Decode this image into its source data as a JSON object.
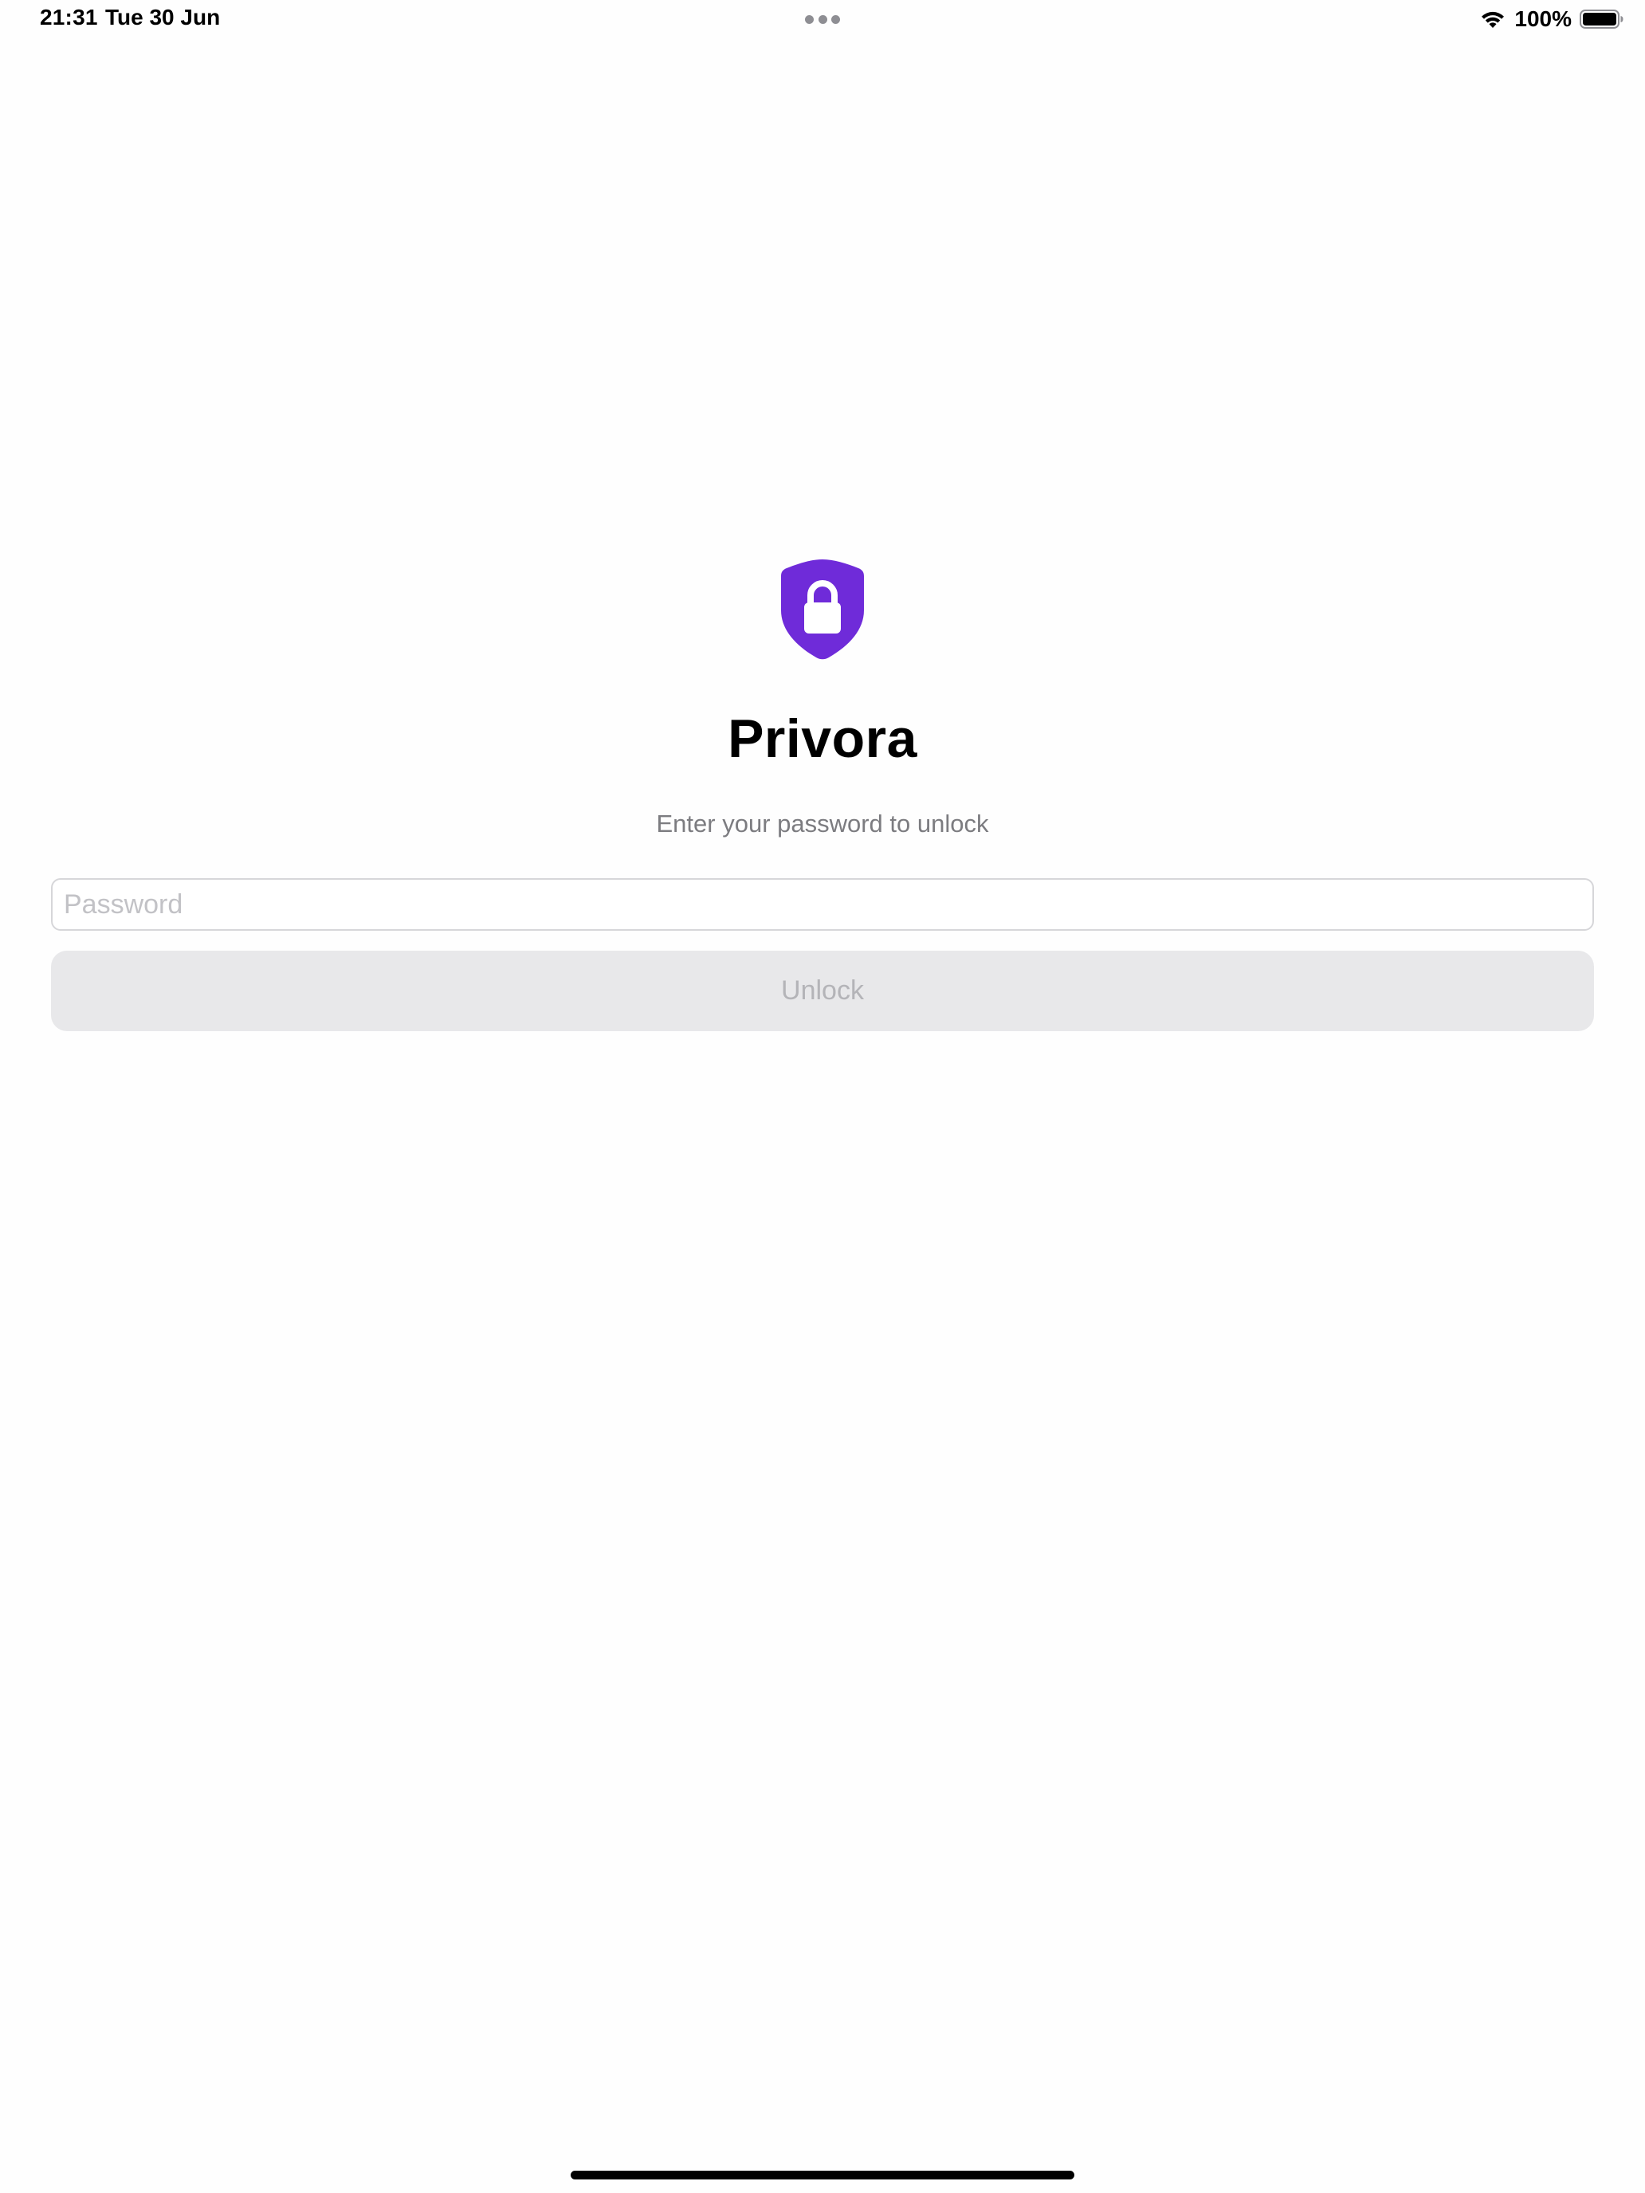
{
  "status_bar": {
    "time": "21:31",
    "date": "Tue 30 Jun",
    "battery_percent": "100%",
    "battery_level": 1.0,
    "icons": [
      "wifi-icon",
      "battery-icon",
      "multitask-dots-icon"
    ]
  },
  "lock_screen": {
    "logo_icon": "shield-lock-icon",
    "logo_color": "#6f2bd9",
    "title": "Privora",
    "subtitle": "Enter your password to unlock",
    "password_field": {
      "value": "",
      "placeholder": "Password"
    },
    "unlock_button": {
      "label": "Unlock",
      "enabled": false
    }
  }
}
